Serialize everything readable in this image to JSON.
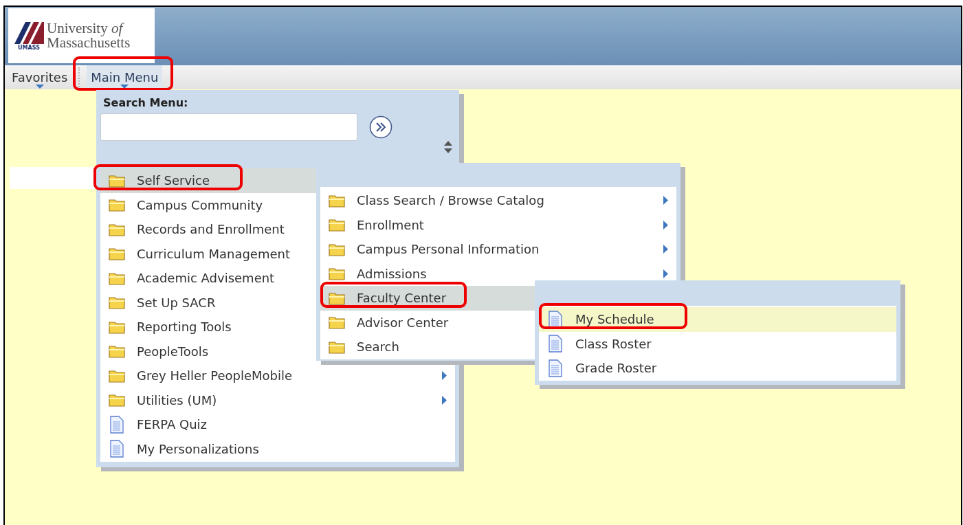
{
  "header": {
    "logo": {
      "name_line1": "University *of*",
      "name_line2": "Massachusetts",
      "badge": "UMASS"
    }
  },
  "nav": [
    {
      "label": "Favorites",
      "selected": false,
      "annotated": false
    },
    {
      "label": "Main Menu",
      "selected": true,
      "annotated": true
    }
  ],
  "search": {
    "label": "Search Menu:"
  },
  "menus": [
    {
      "items": [
        {
          "label": "Self Service",
          "kind": "folder",
          "selected": true,
          "arrow": false,
          "annotated": true
        },
        {
          "label": "Campus Community",
          "kind": "folder",
          "selected": false,
          "arrow": false,
          "annotated": false
        },
        {
          "label": "Records and Enrollment",
          "kind": "folder",
          "selected": false,
          "arrow": false,
          "annotated": false
        },
        {
          "label": "Curriculum Management",
          "kind": "folder",
          "selected": false,
          "arrow": false,
          "annotated": false
        },
        {
          "label": "Academic Advisement",
          "kind": "folder",
          "selected": false,
          "arrow": false,
          "annotated": false
        },
        {
          "label": "Set Up SACR",
          "kind": "folder",
          "selected": false,
          "arrow": false,
          "annotated": false
        },
        {
          "label": "Reporting Tools",
          "kind": "folder",
          "selected": false,
          "arrow": false,
          "annotated": false
        },
        {
          "label": "PeopleTools",
          "kind": "folder",
          "selected": false,
          "arrow": false,
          "annotated": false
        },
        {
          "label": "Grey Heller PeopleMobile",
          "kind": "folder",
          "selected": false,
          "arrow": true,
          "annotated": false
        },
        {
          "label": "Utilities (UM)",
          "kind": "folder",
          "selected": false,
          "arrow": true,
          "annotated": false
        },
        {
          "label": "FERPA Quiz",
          "kind": "page",
          "selected": false,
          "arrow": false,
          "annotated": false
        },
        {
          "label": "My Personalizations",
          "kind": "page",
          "selected": false,
          "arrow": false,
          "annotated": false
        }
      ]
    },
    {
      "items": [
        {
          "label": "Class Search / Browse Catalog",
          "kind": "folder",
          "selected": false,
          "arrow": true,
          "annotated": false
        },
        {
          "label": "Enrollment",
          "kind": "folder",
          "selected": false,
          "arrow": true,
          "annotated": false
        },
        {
          "label": "Campus Personal Information",
          "kind": "folder",
          "selected": false,
          "arrow": true,
          "annotated": false
        },
        {
          "label": "Admissions",
          "kind": "folder",
          "selected": false,
          "arrow": true,
          "annotated": false
        },
        {
          "label": "Faculty Center",
          "kind": "folder",
          "selected": true,
          "arrow": false,
          "annotated": true
        },
        {
          "label": "Advisor Center",
          "kind": "folder",
          "selected": false,
          "arrow": false,
          "annotated": false
        },
        {
          "label": "Search",
          "kind": "folder",
          "selected": false,
          "arrow": false,
          "annotated": false
        }
      ]
    },
    {
      "items": [
        {
          "label": "My Schedule",
          "kind": "page",
          "selected": true,
          "arrow": false,
          "annotated": true
        },
        {
          "label": "Class Roster",
          "kind": "page",
          "selected": false,
          "arrow": false,
          "annotated": false
        },
        {
          "label": "Grade Roster",
          "kind": "page",
          "selected": false,
          "arrow": false,
          "annotated": false
        }
      ]
    }
  ]
}
